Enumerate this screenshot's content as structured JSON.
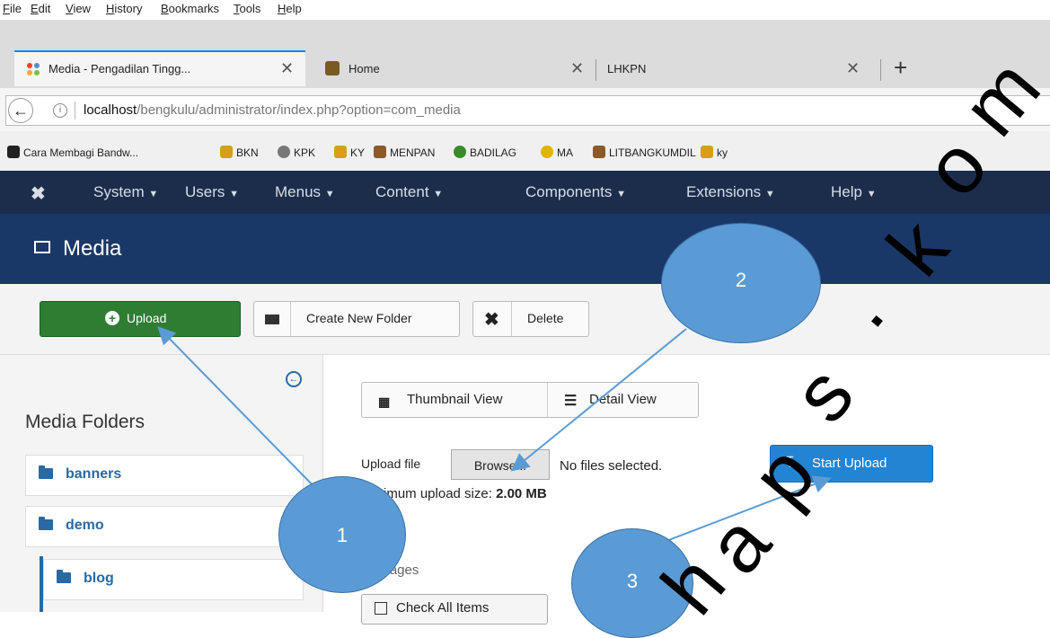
{
  "menu": [
    "File",
    "Edit",
    "View",
    "History",
    "Bookmarks",
    "Tools",
    "Help"
  ],
  "tabs": [
    {
      "title": "Media - Pengadilan Tingg..."
    },
    {
      "title": "Home"
    },
    {
      "title": "LHKPN"
    }
  ],
  "new_tab_glyph": "+",
  "url": {
    "host": "localhost",
    "path": "/bengkulu/administrator/index.php?option=com_media"
  },
  "bookmarks": [
    {
      "label": "Cara Membagi Bandw...",
      "color": "#222"
    },
    {
      "label": "BKN",
      "color": "#d4a017"
    },
    {
      "label": "KPK",
      "color": "#777"
    },
    {
      "label": "KY",
      "color": "#d4a017"
    },
    {
      "label": "MENPAN",
      "color": "#8a5a2b"
    },
    {
      "label": "BADILAG",
      "color": "#3a8a2a"
    },
    {
      "label": "MA",
      "color": "#e0b400"
    },
    {
      "label": "LITBANGKUMDIL",
      "color": "#8a5a2b"
    },
    {
      "label": "ky",
      "color": "#d4a017"
    }
  ],
  "admin_nav": [
    "System",
    "Users",
    "Menus",
    "Content",
    "Components",
    "Extensions",
    "Help"
  ],
  "page_title": "Media",
  "toolbar": {
    "upload": "Upload",
    "create_folder": "Create New Folder",
    "delete": "Delete"
  },
  "sidebar": {
    "heading": "Media Folders",
    "folders": [
      "banners",
      "demo",
      "blog"
    ]
  },
  "views": {
    "thumbnail": "Thumbnail View",
    "detail": "Detail View"
  },
  "upload": {
    "label": "Upload file",
    "browse": "Browse...",
    "status": "No files selected.",
    "start": "Start Upload",
    "max_prefix": "imum upload size: ",
    "max_value": "2.00 MB"
  },
  "images_label": "images",
  "check_all": "Check All Items",
  "callouts": [
    "1",
    "2",
    "3"
  ],
  "watermark": [
    "h",
    "a",
    "p",
    "s",
    ".",
    "k",
    "o",
    "m"
  ]
}
